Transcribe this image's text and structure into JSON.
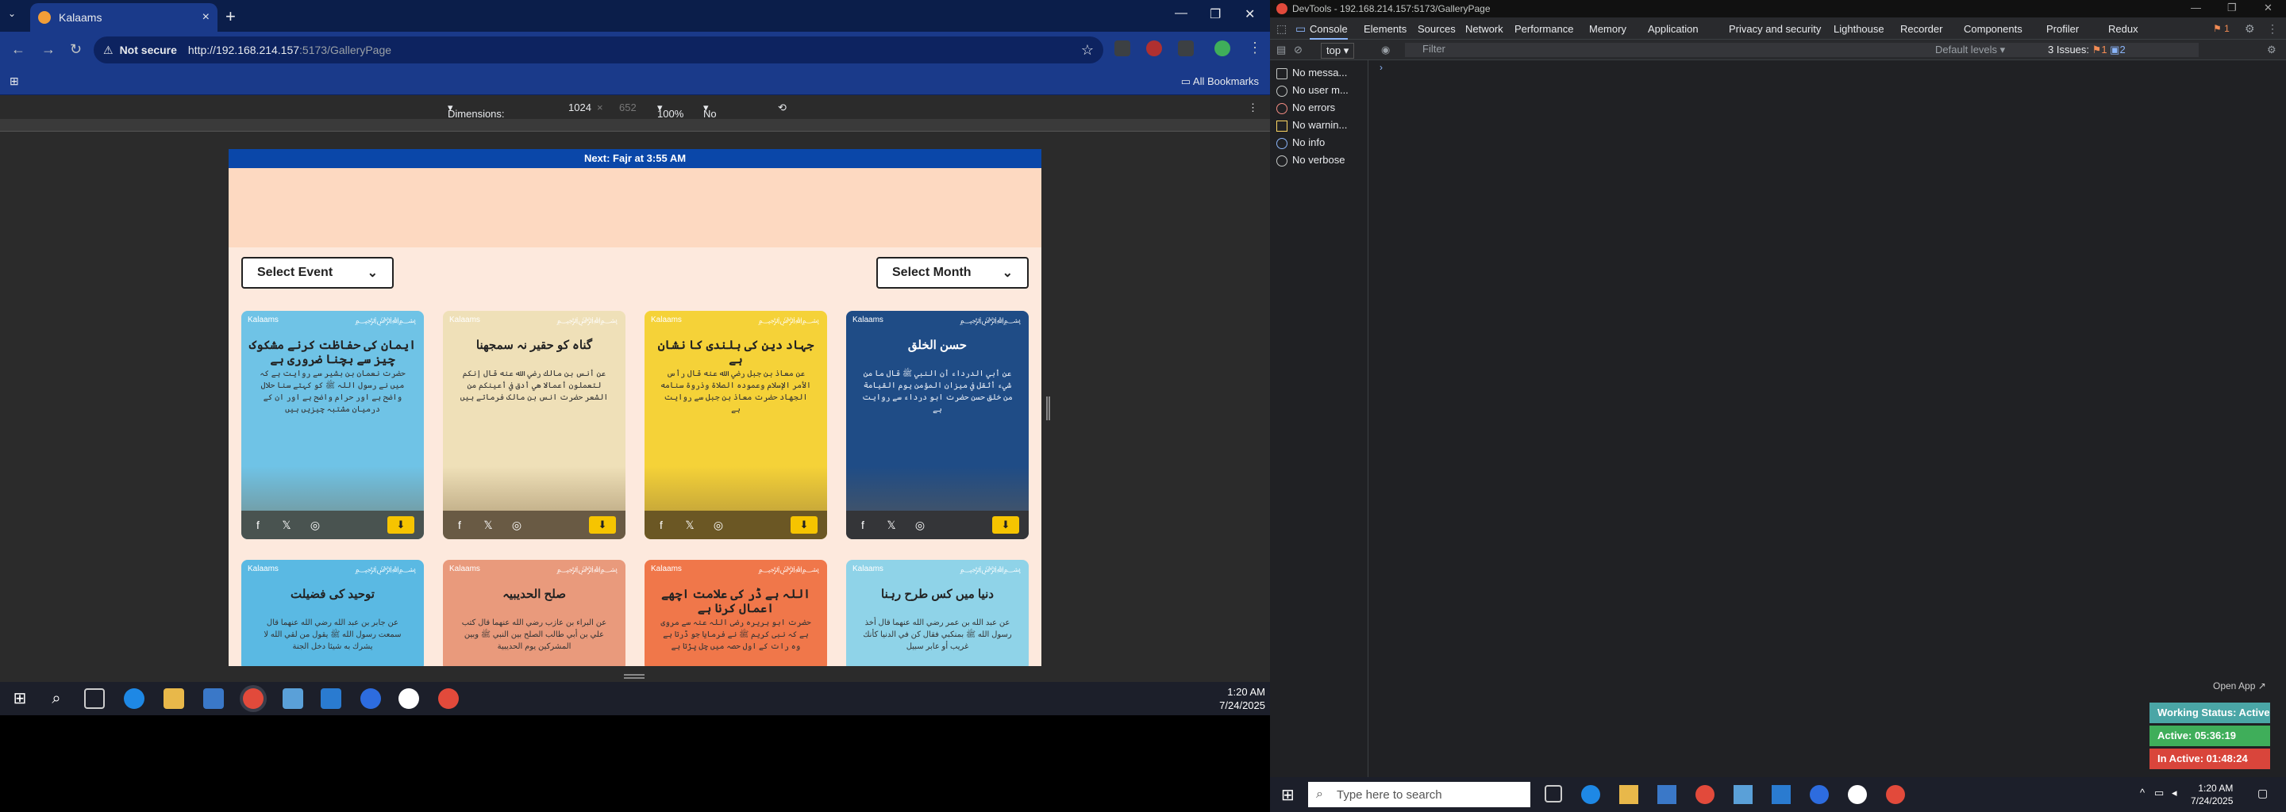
{
  "browser": {
    "tab_title": "Kalaams",
    "new_tab_glyph": "+",
    "tab_close_glyph": "×",
    "not_secure": "Not secure",
    "url_host": "http://192.168.214.157",
    "url_rest": ":5173/GalleryPage",
    "all_bookmarks": "All Bookmarks"
  },
  "device_toolbar": {
    "dimensions_label": "Dimensions: Responsive",
    "width": "1024",
    "height": "652",
    "zoom": "100%",
    "throttling": "No throttling"
  },
  "page": {
    "banner": "Next: Fajr at 3:55 AM",
    "select_event": "Select Event",
    "select_month": "Select Month",
    "brand": "Kalaams",
    "cards": [
      {
        "title": "ایمان کی حفاظت کرنے مشکوک چیز سے بچنا ضروری ہے",
        "body": "حضرت نعمان بن بشیر سے روایت ہے کہ میں نے رسول اللہ ﷺ کو کہتے سنا حلال واضح ہے اور حرام واضح ہے اور ان کے درمیان مشتبہ چیزیں ہیں",
        "color": "#6fc3e6"
      },
      {
        "title": "گناہ کو حقیر نہ سمجھنا",
        "body": "عن أنس بن مالك رضي الله عنه قال إنكم لتعملون أعمالا هي أدق في أعينكم من الشعر حضرت انس بن مالک فرماتے ہیں",
        "color": "#efe0b8"
      },
      {
        "title": "جہاد دین کی بلندی کا نشان ہے",
        "body": "عن معاذ بن جبل رضي الله عنه قال رأس الأمر الإسلام وعموده الصلاة وذروة سنامه الجهاد حضرت معاذ بن جبل سے روایت ہے",
        "color": "#f5d238"
      },
      {
        "title": "حسن الخلق",
        "body": "عن أبي الدرداء أن النبي ﷺ قال ما من شيء أثقل في ميزان المؤمن يوم القيامة من خلق حسن حضرت ابو درداء سے روایت ہے",
        "color": "#1f4c86"
      },
      {
        "title": "توحید کی فضیلت",
        "body": "عن جابر بن عبد الله رضي الله عنهما قال سمعت رسول الله ﷺ يقول من لقي الله لا يشرك به شيئا دخل الجنة",
        "color": "#5ab9e3"
      },
      {
        "title": "صلح الحدیبیہ",
        "body": "عن البراء بن عازب رضي الله عنهما قال كتب علي بن أبي طالب الصلح بين النبي ﷺ وبين المشركين يوم الحديبية",
        "color": "#e99a7c"
      },
      {
        "title": "اللہ ہے ڈر کی علامت اچھے اعمال کرنا ہے",
        "body": "حضرت ابو ہریرہ رضی اللہ عنہ سے مروی ہے کہ نبی کریم ﷺ نے فرمایا جو ڈرتا ہے وہ رات کے اول حصہ میں چل پڑتا ہے",
        "color": "#f0774a"
      },
      {
        "title": "دنیا میں کس طرح رہنا",
        "body": "عن عبد الله بن عمر رضي الله عنهما قال أخذ رسول الله ﷺ بمنكبي فقال كن في الدنيا كأنك غريب أو عابر سبيل",
        "color": "#8fd3e8"
      }
    ]
  },
  "taskbar_left": {
    "time": "1:20 AM",
    "date": "7/24/2025"
  },
  "devtools": {
    "window_title": "DevTools - 192.168.214.157:5173/GalleryPage",
    "tabs": [
      "Console",
      "Elements",
      "Sources",
      "Network",
      "Performance",
      "Memory",
      "Application",
      "Privacy and security",
      "Lighthouse",
      "Recorder",
      "Components",
      "Profiler",
      "Redux"
    ],
    "context": "top",
    "filter_placeholder": "Filter",
    "default_levels": "Default levels",
    "issues": "3 Issues:",
    "issue_count_a": "1",
    "issue_count_b": "2",
    "badge_count": "1",
    "sidebar": [
      "No messa...",
      "No user m...",
      "No errors",
      "No warnin...",
      "No info",
      "No verbose"
    ]
  },
  "taskbar_right": {
    "search_placeholder": "Type here to search",
    "time": "1:20 AM",
    "date": "7/24/2025"
  },
  "tracker": {
    "open_app": "Open App",
    "working_status": "Working Status: Active",
    "active": "Active: 05:36:19",
    "inactive": "In Active: 01:48:24"
  },
  "colors": {
    "banner": "#0a47a9",
    "download": "#f6c400",
    "status_green": "#3fae5a",
    "status_red": "#d9453b",
    "status_teal": "#4aa6a6"
  }
}
